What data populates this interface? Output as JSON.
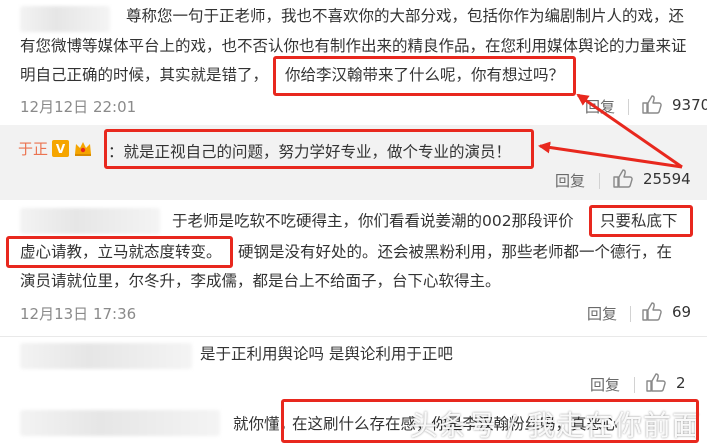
{
  "comments": [
    {
      "lines": [
        "尊称您一句于正老师，我也不喜欢你的大部分戏，包括你作为编剧制片人的戏，还",
        "有您微博等媒体平台上的戏，也不否认你也有制作出来的精良作品，在您利用媒体舆论的力量来证",
        "明自己正确的时候，其实就是错了，",
        "你给李汉翰带来了什么呢，你有想过吗？"
      ],
      "time": "12月12日 22:01",
      "reply_label": "回复",
      "likes": "9370"
    },
    {
      "author": "于正",
      "verified_badge": "V",
      "text": "：就是正视自己的问题，努力学好专业，做个专业的演员！",
      "reply_label": "回复",
      "likes": "25594"
    },
    {
      "lines": [
        "于老师是吃软不吃硬得主，你们看看说姜潮的002那段评价",
        "只要私底下",
        "虚心请教，立马就态度转变。",
        "硬钢是没有好处的。还会被黑粉利用，那些老师都一个德行，在",
        "演员请就位里，尔冬升，李成儒，都是台上不给面子，台下心软得主。"
      ],
      "time": "12月13日 17:36",
      "reply_label": "回复",
      "likes": "69"
    },
    {
      "text": "是于正利用舆论吗 是舆论利用于正吧",
      "reply_label": "回复",
      "likes": "2"
    },
    {
      "text_left": "就你懂，",
      "text_boxed": "在这刷什么存在感，你是李汉翰粉丝吗，真恶心",
      "watermark": "头条号 / 我走在你前面"
    }
  ],
  "colors": {
    "annotation_red": "#e8281e",
    "author": "#eb7350",
    "badge": "#f5a500"
  },
  "icons": [
    "thumbs-up-icon",
    "verified-v-icon",
    "crown-icon",
    "arrow-icon"
  ]
}
